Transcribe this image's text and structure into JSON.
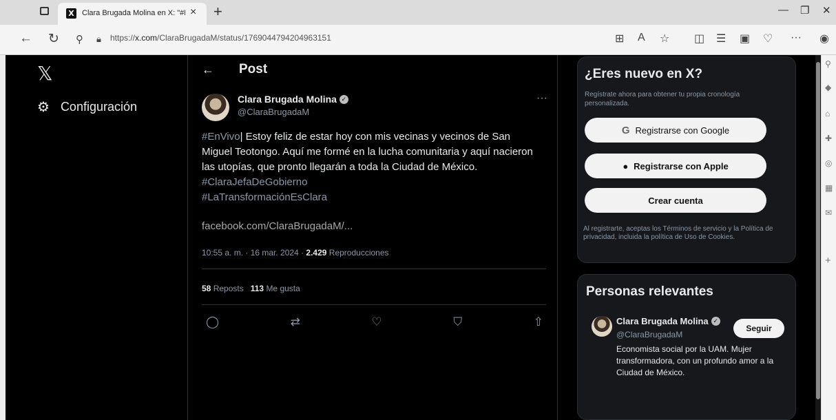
{
  "browser": {
    "tab_title": "Clara Brugada Molina en X: \"#E",
    "tab_favicon": "X",
    "new_tab": "+",
    "url_prefix": "https://",
    "url_domain": "x.com",
    "url_path": "/ClaraBrugadaM/status/1769044794204963151"
  },
  "sidebar": {
    "logo": "𝕏",
    "settings_label": "Configuración"
  },
  "main": {
    "header_title": "Post",
    "author_name": "Clara Brugada Molina",
    "author_handle": "@ClaraBrugadaM",
    "text_hashtag": "#EnVivo",
    "text_line1": "| Estoy feliz de estar hoy con mis vecinas y vecinos de San",
    "text_line2": "Miguel Teotongo. Aquí me formé en la lucha comunitaria y aquí nacieron",
    "text_line3": "las utopías, que pronto llegarán a toda la Ciudad de México.",
    "hashtag1": "#ClaraJefaDeGobierno",
    "hashtag2": "#LaTransformaciónEsClara",
    "link": "facebook.com/ClaraBrugadaM/...",
    "meta_time": "10:55 a. m. · 16 mar. 2024 · ",
    "meta_views": "2.429",
    "meta_views_label": " Reproducciones",
    "reposts_count": "58",
    "reposts_label": "Reposts",
    "likes_count": "113",
    "likes_label": "Me gusta"
  },
  "signup": {
    "title": "¿Eres nuevo en X?",
    "subtitle": "Regístrate ahora para obtener tu propia cronología personalizada.",
    "google_label": "Registrarse con Google",
    "apple_label": "Registrarse con Apple",
    "create_label": "Crear cuenta",
    "legal": "Al registrarte, aceptas los Términos de servicio y la Política de privacidad, incluida la política de Uso de Cookies."
  },
  "relevant": {
    "title": "Personas relevantes",
    "name": "Clara Brugada Molina",
    "handle": "@ClaraBrugadaM",
    "follow_label": "Seguir",
    "bio": "Economista social por la UAM. Mujer transformadora, con un profundo amor a la Ciudad de México."
  },
  "icons": [
    "back-arrow-icon",
    "refresh-icon",
    "search-icon",
    "lock-icon",
    "gear-icon",
    "reply-icon",
    "repost-icon",
    "like-icon",
    "bookmark-icon",
    "share-icon",
    "google-icon",
    "apple-icon",
    "verified-icon"
  ]
}
